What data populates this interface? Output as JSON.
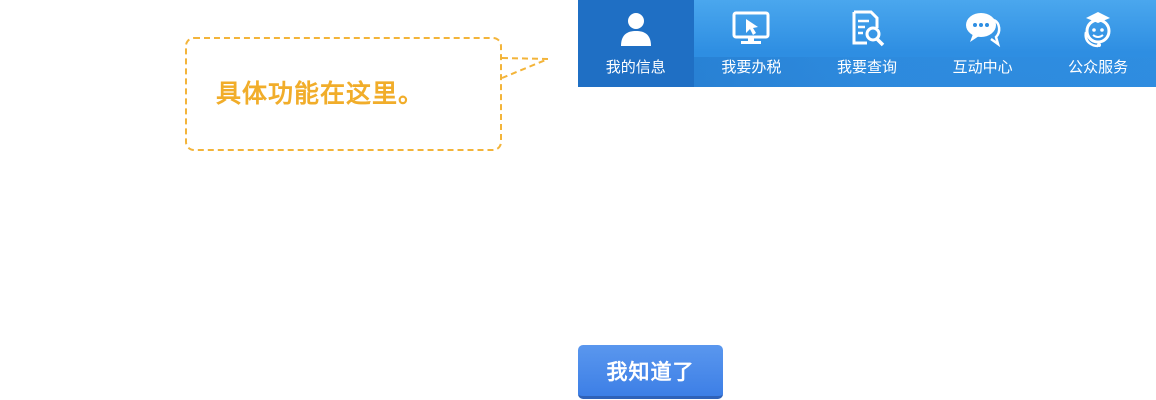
{
  "tooltip": {
    "text": "具体功能在这里。"
  },
  "nav": {
    "items": [
      {
        "label": "我的信息",
        "icon": "user-icon",
        "active": true
      },
      {
        "label": "我要办税",
        "icon": "monitor-cursor-icon",
        "active": false
      },
      {
        "label": "我要查询",
        "icon": "document-search-icon",
        "active": false
      },
      {
        "label": "互动中心",
        "icon": "chat-bubbles-icon",
        "active": false
      },
      {
        "label": "公众服务",
        "icon": "service-person-icon",
        "active": false
      }
    ]
  },
  "button": {
    "label": "我知道了"
  },
  "colors": {
    "tooltip": "#f3b43a",
    "nav": "#2e8ee2",
    "nav_active": "#1f6fc4",
    "button": "#4a88ea"
  }
}
